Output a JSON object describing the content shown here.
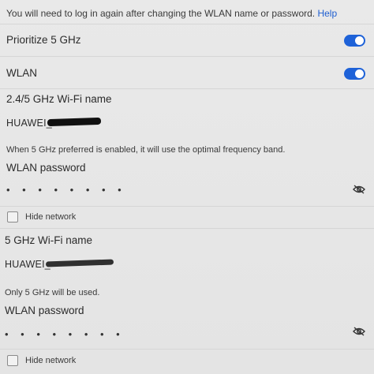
{
  "notice": {
    "text": "You will need to log in again after changing the WLAN name or password.",
    "help_label": "Help"
  },
  "prioritize_5ghz": {
    "label": "Prioritize 5 GHz",
    "enabled": true
  },
  "wlan": {
    "label": "WLAN",
    "enabled": true
  },
  "ssid_24_5": {
    "label": "2.4/5 GHz Wi-Fi name",
    "value": "HUAWEI_"
  },
  "note_5ghz_preferred": "When 5 GHz preferred is enabled, it will use the optimal frequency band.",
  "password_1": {
    "label": "WLAN password",
    "value": "• • • • • • • •"
  },
  "hide_network_1": {
    "label": "Hide network",
    "checked": false
  },
  "ssid_5": {
    "label": "5 GHz Wi-Fi name",
    "value": "HUAWEI_"
  },
  "note_only_5": "Only 5 GHz will be used.",
  "password_2": {
    "label": "WLAN password",
    "value": "• • • • • • • •"
  },
  "hide_network_2": {
    "label": "Hide network",
    "checked": false
  },
  "colors": {
    "accent": "#1e62d8",
    "link": "#1f5fd1",
    "background": "#e6e6e6"
  },
  "icons": {
    "toggle_on": "toggle-switch-icon",
    "eye_off": "eye-off-icon",
    "checkbox": "checkbox-icon"
  }
}
